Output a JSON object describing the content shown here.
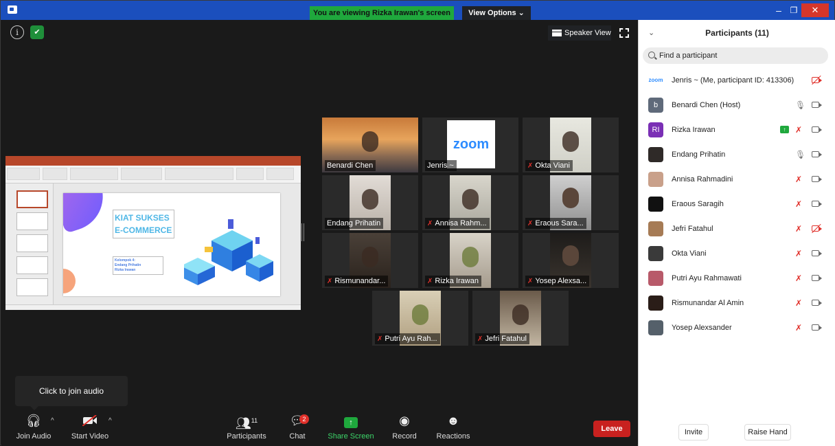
{
  "titlebar": {
    "banner": "You are viewing Rizka Irawan's screen",
    "view_options": "View Options ⌄",
    "minimize": "–",
    "maximize": "❐",
    "close": "✕"
  },
  "stage": {
    "speaker_view": "Speaker View"
  },
  "shared_slide": {
    "title_line1": "KIAT SUKSES",
    "title_line2": "E-COMMERCE",
    "sub_line1": "Kelompok 4:",
    "sub_line2": "Endang Prihatin",
    "sub_line3": "Rizka Irawan"
  },
  "video_tiles": [
    {
      "name": "Benardi Chen",
      "muted": false,
      "active": true
    },
    {
      "name": "Jenris ~",
      "muted": false,
      "active": false
    },
    {
      "name": "Okta Viani",
      "muted": true,
      "active": false
    },
    {
      "name": "Endang Prihatin",
      "muted": false,
      "active": false
    },
    {
      "name": "Annisa Rahm...",
      "muted": true,
      "active": false
    },
    {
      "name": "Eraous Sara...",
      "muted": true,
      "active": false
    },
    {
      "name": "Rismunandar...",
      "muted": true,
      "active": false
    },
    {
      "name": "Rizka Irawan",
      "muted": true,
      "active": false
    },
    {
      "name": "Yosep Alexsa...",
      "muted": true,
      "active": false
    },
    {
      "name": "Putri Ayu Rah...",
      "muted": true,
      "active": false
    },
    {
      "name": "Jefri Fatahul",
      "muted": true,
      "active": false
    }
  ],
  "zoom_logo_text": "zoom",
  "tooltip": "Click to join audio",
  "toolbar": {
    "join_audio": "Join Audio",
    "start_video": "Start Video",
    "participants": "Participants",
    "participants_count": "11",
    "chat": "Chat",
    "chat_badge": "2",
    "share_screen": "Share Screen",
    "record": "Record",
    "reactions": "Reactions",
    "leave": "Leave"
  },
  "panel": {
    "title": "Participants (11)",
    "search_placeholder": "Find a participant",
    "participants": [
      {
        "avatar": "zoom",
        "name": "Jenris ~ (Me, participant ID: 413306)",
        "color": "#ffffff"
      },
      {
        "avatar": "b",
        "name": "Benardi Chen (Host)",
        "color": "#5f6a7a"
      },
      {
        "avatar": "RI",
        "name": "Rizka Irawan",
        "color": "#7a2fb5"
      },
      {
        "avatar": "",
        "name": "Endang Prihatin",
        "color": "#2f2a28"
      },
      {
        "avatar": "",
        "name": "Annisa Rahmadini",
        "color": "#c9a08a"
      },
      {
        "avatar": "",
        "name": "Eraous Saragih",
        "color": "#111111"
      },
      {
        "avatar": "",
        "name": "Jefri Fatahul",
        "color": "#a67b55"
      },
      {
        "avatar": "",
        "name": "Okta Viani",
        "color": "#3a3a3a"
      },
      {
        "avatar": "",
        "name": "Putri Ayu Rahmawati",
        "color": "#b85a6a"
      },
      {
        "avatar": "",
        "name": "Rismunandar Al Amin",
        "color": "#2a1d18"
      },
      {
        "avatar": "",
        "name": "Yosep Alexsander",
        "color": "#55606a"
      }
    ],
    "invite": "Invite",
    "raise_hand": "Raise Hand"
  },
  "colors": {
    "banner_green": "#1fa83d",
    "titlebar_blue": "#1b4fbd",
    "leave_red": "#c8211f",
    "active_speaker": "#e9e57a",
    "muted_red": "#e0302a"
  }
}
